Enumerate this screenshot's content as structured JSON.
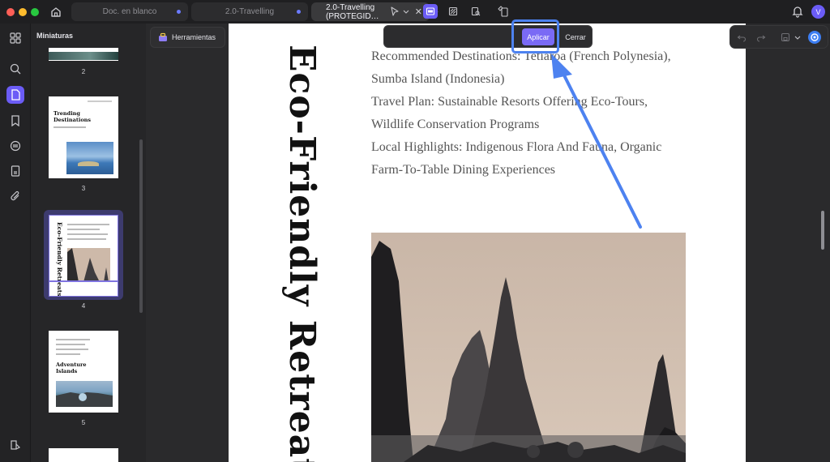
{
  "tabs": [
    {
      "label": "Doc. en blanco",
      "modified": true
    },
    {
      "label": "2.0-Travelling",
      "modified": true
    },
    {
      "label": "2.0-Travelling (PROTEGIDO)",
      "display": "2.0-Travelling (PROTEGID…",
      "active": true
    }
  ],
  "user": {
    "initial": "V"
  },
  "sidebar": {
    "title": "Miniaturas"
  },
  "thumbnails": [
    {
      "page": "2"
    },
    {
      "page": "3",
      "heading": "Trending Destinations"
    },
    {
      "page": "4",
      "heading": "Eco-Friendly Retreats",
      "selected": true
    },
    {
      "page": "5",
      "heading": "Adventure Islands"
    }
  ],
  "toolbar": {
    "tools_label": "Herramientas",
    "apply_label": "Aplicar",
    "close_label": "Cerrar"
  },
  "document": {
    "vertical_title": "Eco-Friendly Retreat",
    "lines": [
      "Recommended Destinations: Tetiaroa (French Polynesia),",
      "Sumba Island (Indonesia)",
      "Travel Plan: Sustainable Resorts Offering Eco-Tours,",
      "Wildlife Conservation Programs",
      "Local Highlights: Indigenous Flora And Fauna, Organic",
      "Farm-To-Table Dining Experiences"
    ]
  },
  "colors": {
    "accent": "#6b5cf6",
    "annotation": "#4d82f0",
    "dark_bg": "#2a2a2c"
  }
}
